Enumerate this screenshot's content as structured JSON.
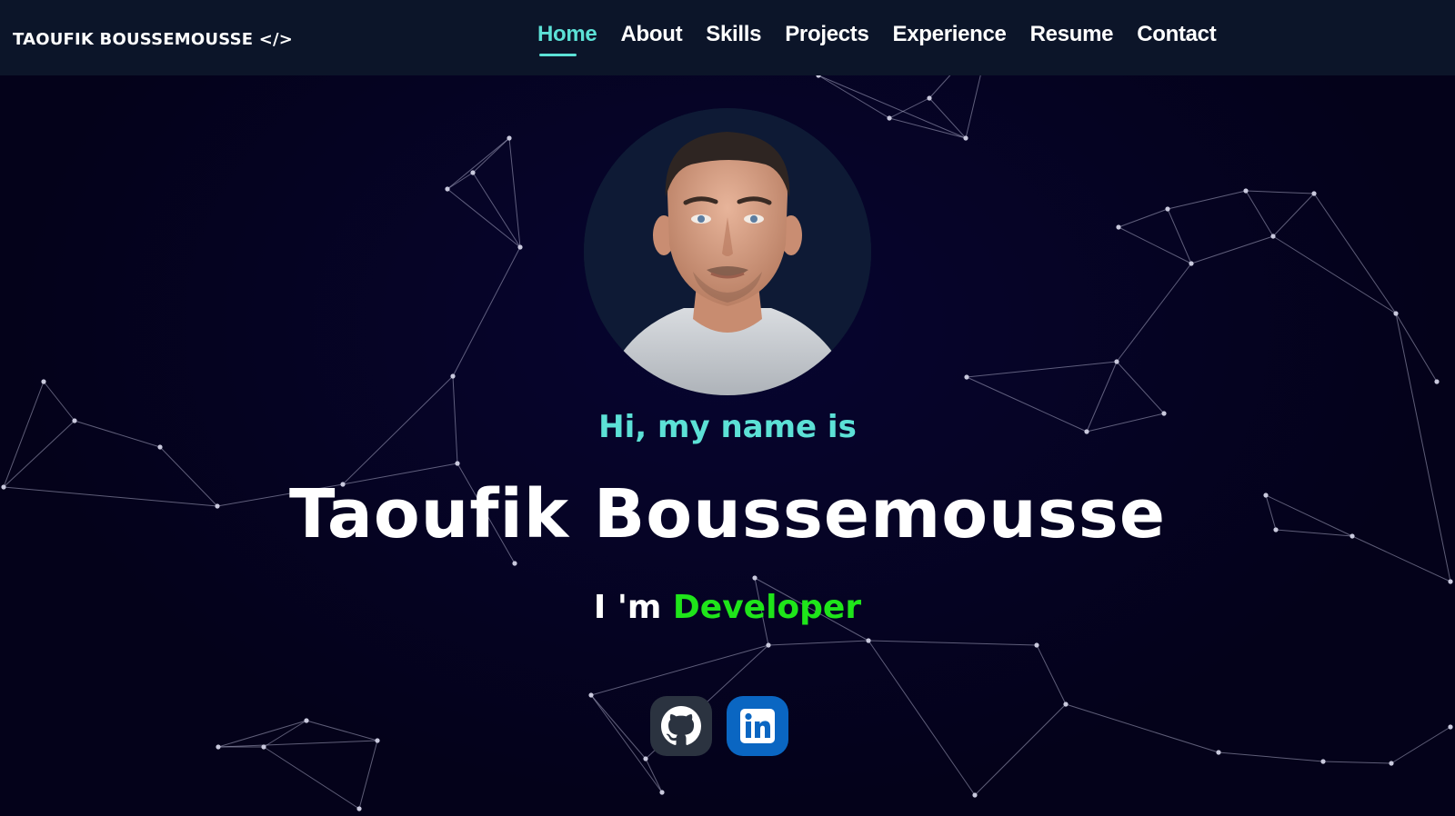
{
  "navbar": {
    "brand": "TAOUFIK BOUSSEMOUSSE </>",
    "links": [
      {
        "label": "Home",
        "active": true
      },
      {
        "label": "About"
      },
      {
        "label": "Skills"
      },
      {
        "label": "Projects"
      },
      {
        "label": "Experience"
      },
      {
        "label": "Resume"
      },
      {
        "label": "Contact"
      }
    ]
  },
  "hero": {
    "greeting": "Hi, my name is",
    "name": "Taoufik Boussemousse",
    "role_prefix": "I 'm ",
    "role_word": "Developer"
  },
  "socials": [
    {
      "icon": "github-icon"
    },
    {
      "icon": "linkedin-icon"
    }
  ],
  "colors": {
    "accent": "#5ce1d6",
    "role": "#1fe51a",
    "navbar_bg": "#0c1529",
    "page_bg": "#04021a",
    "github_btn": "#2b3340",
    "linkedin_btn": "#0a66c2"
  }
}
